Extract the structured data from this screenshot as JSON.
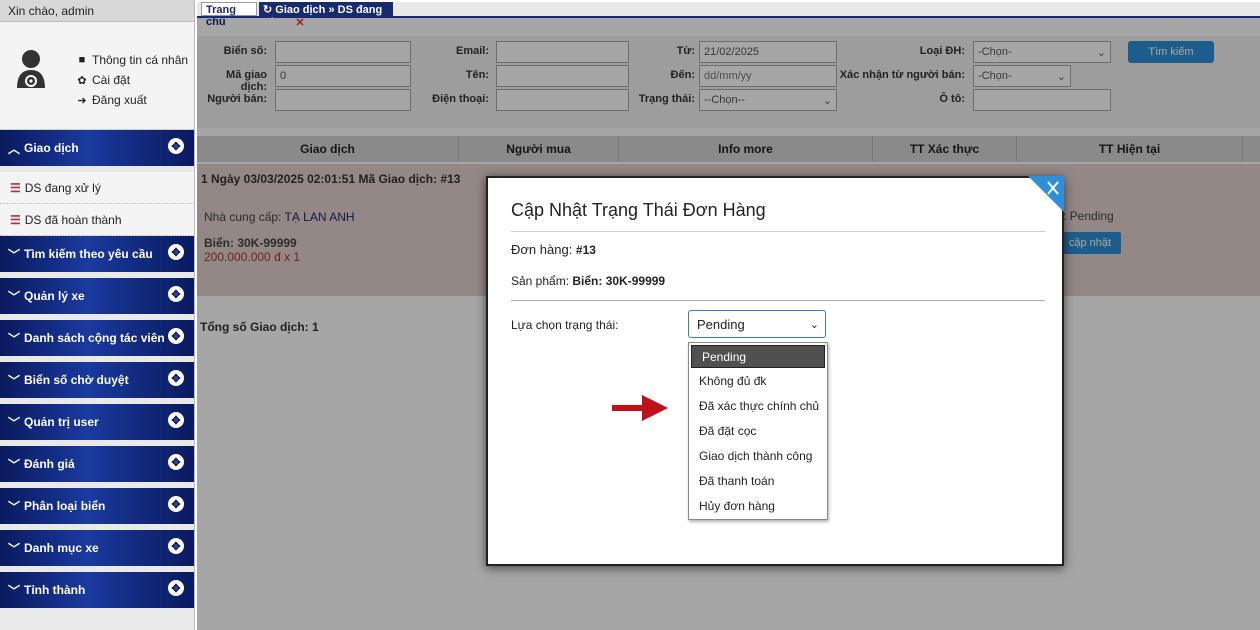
{
  "sidebar": {
    "greeting": "Xin chào, admin",
    "profile_links": [
      {
        "label": "Thông tin cá nhân",
        "icon": "comment-icon"
      },
      {
        "label": "Cài đặt",
        "icon": "gear-icon"
      },
      {
        "label": "Đăng xuất",
        "icon": "logout-icon"
      }
    ],
    "menu_giao_dich": "Giao dịch",
    "sub_items": [
      "DS đang xử lý",
      "DS đã hoàn thành"
    ],
    "menus": [
      "Tìm kiếm theo yêu cầu",
      "Quản lý xe",
      "Danh sách cộng tác viên",
      "Biển số chờ duyệt",
      "Quản trị user",
      "Đánh giá",
      "Phân loại biển",
      "Danh mục xe",
      "Tỉnh thành"
    ]
  },
  "tabs": {
    "home": "Trang chủ",
    "active": "Giao dịch » DS đang xử lý"
  },
  "filters": {
    "bien_so": "Biển số:",
    "ma_gd": "Mã giao dịch:",
    "ma_gd_value": "0",
    "nguoi_ban": "Người bán:",
    "email": "Email:",
    "ten": "Tên:",
    "dien_thoai": "Điện thoại:",
    "tu": "Từ:",
    "tu_value": "21/02/2025",
    "den": "Đến:",
    "den_placeholder": "dd/mm/yy",
    "trang_thai": "Trạng thái:",
    "trang_thai_value": "--Chọn--",
    "loai_dh": "Loại ĐH:",
    "loai_dh_value": "-Chọn-",
    "xac_nhan": "Xác nhận từ người bán:",
    "xac_nhan_value": "-Chọn-",
    "o_to": "Ô tô:",
    "search_button": "Tìm kiếm"
  },
  "table": {
    "headers": [
      "Giao dịch",
      "Người mua",
      "Info more",
      "TT Xác thực",
      "TT Hiện tại"
    ]
  },
  "order": {
    "title": "1   Ngày 03/03/2025 02:01:51   Mã Giao dịch: #13",
    "supplier_label": "Nhà cung cấp: ",
    "supplier": "TẠ LAN ANH",
    "plate": "Biển: 30K-99999",
    "price": "200.000.000 đ x 1",
    "status_text": "r: Pending",
    "update_button": "cập nhật"
  },
  "total": "Tổng số Giao dịch: 1",
  "modal": {
    "title": "Cập Nhật Trạng Thái Đơn Hàng",
    "order_label": "Đơn hàng: ",
    "order_value": "#13",
    "product_label": "Sản phẩm: ",
    "product_value": "Biển: 30K-99999",
    "status_label": "Lựa chọn trạng thái:",
    "selected": "Pending",
    "options": [
      "Pending",
      "Không đủ đk",
      "Đã xác thực chính chủ",
      "Đã đặt cọc",
      "Giao dịch thành công",
      "Đã thanh toán",
      "Hủy đơn hàng"
    ]
  },
  "colors": {
    "menu_bg": "#0a1a5e",
    "accent": "#2d8fd8",
    "order_bg": "#e4d2d0",
    "arrow": "#c0101a",
    "close_bg": "#2d8fd8"
  }
}
